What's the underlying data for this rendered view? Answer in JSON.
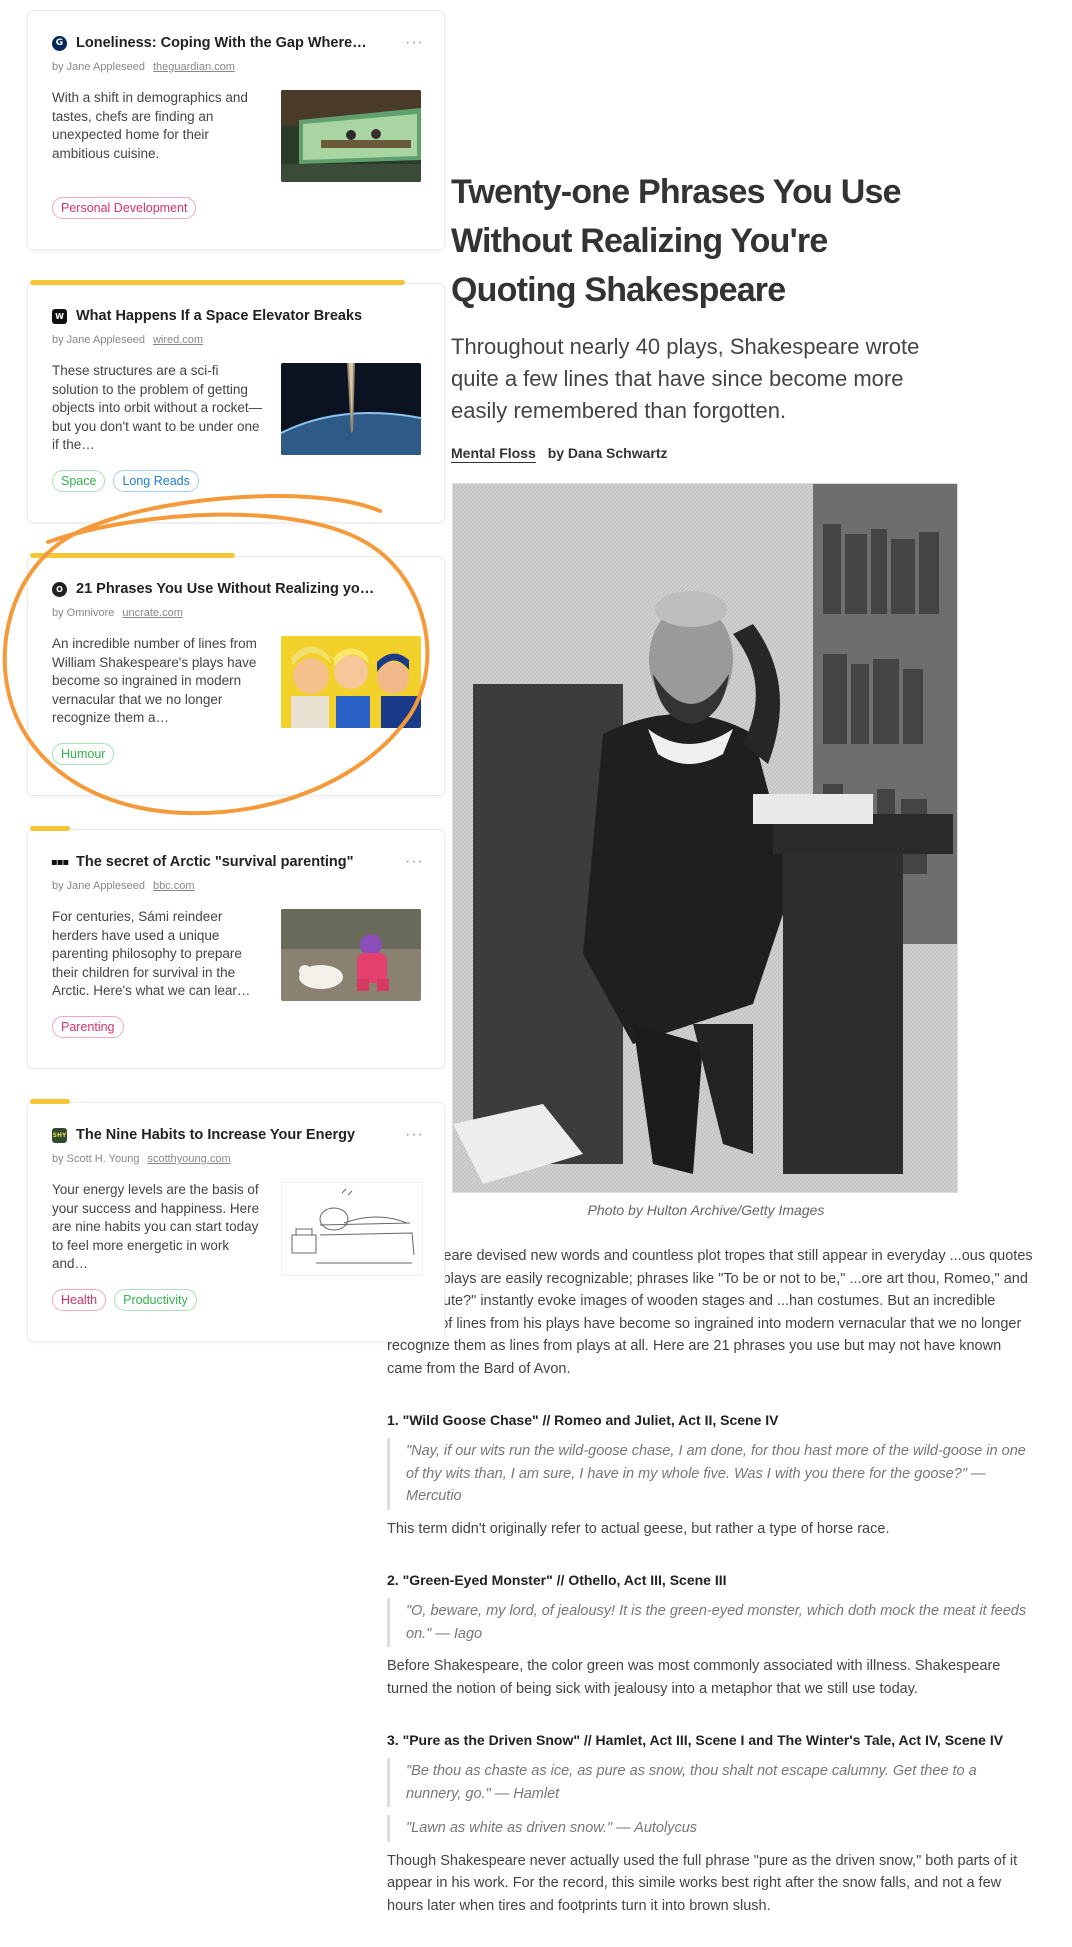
{
  "cards": [
    {
      "title": "Loneliness: Coping With the Gap Where…",
      "author": "by Jane Appleseed",
      "domain": "theguardian.com",
      "excerpt": "With a shift in demographics and tastes, chefs are finding an unexpected home for their ambitious cuisine.",
      "tags": [
        "Personal Development"
      ],
      "more": "···",
      "icon": "guardian-icon"
    },
    {
      "title": "What Happens If a Space Elevator Breaks",
      "author": "by Jane Appleseed",
      "domain": "wired.com",
      "excerpt": "These structures are a sci-fi solution to the problem of getting objects into orbit without a rocket—but you don't want to be under one if the…",
      "tags": [
        "Space",
        "Long Reads"
      ],
      "icon": "wired-icon"
    },
    {
      "title": "21 Phrases You Use Without Realizing yo…",
      "author": "by Omnivore",
      "domain": "uncrate.com",
      "excerpt": "An incredible number of lines from William Shakespeare's plays have become so ingrained in modern vernacular that we no longer recognize them a…",
      "tags": [
        "Humour"
      ],
      "icon": "omnivore-icon"
    },
    {
      "title": "The secret of Arctic \"survival parenting\"",
      "author": "by Jane Appleseed",
      "domain": "bbc.com",
      "excerpt": "For centuries, Sámi reindeer herders have used a unique parenting philosophy to prepare their children for survival in the Arctic. Here's what we can lear…",
      "tags": [
        "Parenting"
      ],
      "more": "···",
      "icon": "bbc-icon"
    },
    {
      "title": "The Nine Habits to Increase Your Energy",
      "author": "by Scott H. Young",
      "domain": "scotthyoung.com",
      "excerpt": "Your energy levels are the basis of your success and happiness. Here are nine habits you can start today to feel more energetic in work and…",
      "tags": [
        "Health",
        "Productivity"
      ],
      "more": "···",
      "icon": "shy-icon",
      "icon_text": "SHY"
    }
  ],
  "article": {
    "headline": "Twenty-one Phrases You Use Without Realizing You're Quoting Shakespeare",
    "dek": "Throughout nearly 40 plays, Shakespeare wrote quite a few lines that have since become more easily remembered than forgotten.",
    "publication": "Mental Floss",
    "author": "by Dana Schwartz",
    "caption": "Photo by Hulton Archive/Getty Images",
    "intro": "Shakespeare devised new words and countless plot tropes that still appear in everyday ...ous quotes from his plays are easily recognizable; phrases like \"To be or not to be,\" ...ore art thou, Romeo,\" and \"et tu, Brute?\" instantly evoke images of wooden stages and ...han costumes. But an incredible number of lines from his plays have become so ingrained into modern vernacular that we no longer recognize them as lines from plays at all. Here are 21 phrases you use but may not have known came from the Bard of Avon.",
    "sections": [
      {
        "heading": "1. \"Wild Goose Chase\" // Romeo and Juliet, Act II, Scene IV",
        "quotes": [
          "\"Nay, if our wits run the wild-goose chase, I am done, for thou hast more of the wild-goose in one of thy wits than, I am sure, I have in my whole five. Was I with you there for the goose?\" — Mercutio"
        ],
        "text": "This term didn't originally refer to actual geese, but rather a type of horse race."
      },
      {
        "heading": "2. \"Green-Eyed Monster\" // Othello, Act III, Scene III",
        "quotes": [
          "\"O, beware, my lord, of jealousy! It is the green-eyed monster, which doth mock the meat it feeds on.\" — Iago"
        ],
        "text": "Before Shakespeare, the color green was most commonly associated with illness. Shakespeare turned the notion of being sick with jealousy into a metaphor that we still use today."
      },
      {
        "heading": "3. \"Pure as the Driven Snow\" // Hamlet, Act III, Scene I and The Winter's Tale, Act IV, Scene IV",
        "quotes": [
          "\"Be thou as chaste as ice, as pure as snow, thou shalt not escape calumny. Get thee to a nunnery, go.\" — Hamlet",
          "\"Lawn as white as driven snow.\" — Autolycus"
        ],
        "text": "Though Shakespeare never actually used the full phrase \"pure as the driven snow,\" both parts of it appear in his work. For the record, this simile works best right after the snow falls, and not a few hours later when tires and footprints turn it into brown slush."
      }
    ]
  },
  "colors": {
    "accent_bar": "#f5c637",
    "circle": "#f59a3b",
    "tag_pink": "#d6336c",
    "tag_green": "#37b24d",
    "tag_blue": "#1c7ed6"
  }
}
